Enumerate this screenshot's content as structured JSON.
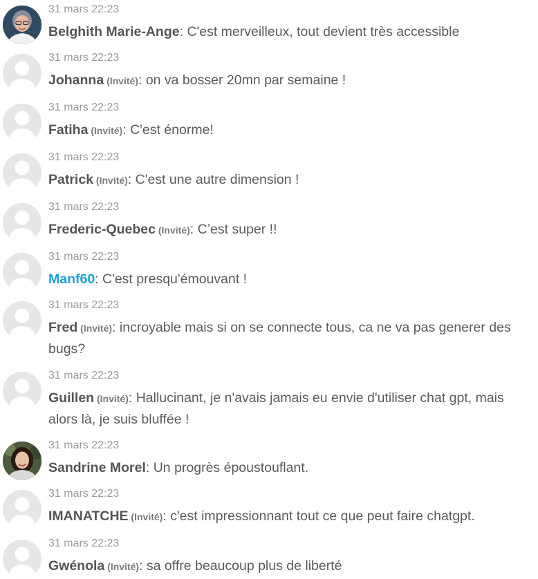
{
  "messages": [
    {
      "time": "31 mars 22:23",
      "author": "Belghith Marie-Ange",
      "tag": "",
      "separator": ": ",
      "text": "C'est merveilleux, tout devient très accessible",
      "avatar": "photo-woman-glasses"
    },
    {
      "time": "31 mars 22:23",
      "author": "Johanna",
      "tag": " (Invité)",
      "separator": ": ",
      "text": "on va bosser 20mn par semaine !",
      "avatar": "default-user-icon"
    },
    {
      "time": "31 mars 22:23",
      "author": "Fatiha",
      "tag": " (Invité)",
      "separator": ": ",
      "text": "C'est énorme!",
      "avatar": "default-user-icon"
    },
    {
      "time": "31 mars 22:23",
      "author": "Patrick",
      "tag": " (Invité)",
      "separator": ": ",
      "text": "C'est une autre dimension !",
      "avatar": "default-user-icon"
    },
    {
      "time": "31 mars 22:23",
      "author": "Frederic-Quebec",
      "tag": " (Invité)",
      "separator": ": ",
      "text": "C’est super !!",
      "avatar": "default-user-icon"
    },
    {
      "time": "31 mars 22:23",
      "author": "Manf60",
      "tag": "",
      "separator": ": ",
      "text": "C'est presqu'émouvant !",
      "avatar": "default-user-icon",
      "author_color": "#1aa3d8"
    },
    {
      "time": "31 mars 22:23",
      "author": "Fred",
      "tag": " (Invité)",
      "separator": ": ",
      "text": "incroyable mais si on se connecte tous, ca ne va pas generer des bugs?",
      "avatar": "default-user-icon"
    },
    {
      "time": "31 mars 22:23",
      "author": "Guillen",
      "tag": " (Invité)",
      "separator": ": ",
      "text": "Hallucinant, je n'avais jamais eu envie d'utiliser chat gpt, mais alors là, je suis bluffée !",
      "avatar": "default-user-icon"
    },
    {
      "time": "31 mars 22:23",
      "author": "Sandrine Morel",
      "tag": "",
      "separator": ": ",
      "text": "Un progrès époustouflant.",
      "avatar": "photo-woman-dark-hair"
    },
    {
      "time": "31 mars 22:23",
      "author": "IMANATCHE",
      "tag": " (Invité)",
      "separator": ": ",
      "text": "c'est impressionnant tout ce que peut faire chatgpt.",
      "avatar": "default-user-icon"
    },
    {
      "time": "31 mars 22:23",
      "author": "Gwénola",
      "tag": " (Invité)",
      "separator": ": ",
      "text": "sa offre beaucoup plus de liberté",
      "avatar": "default-user-icon"
    }
  ]
}
